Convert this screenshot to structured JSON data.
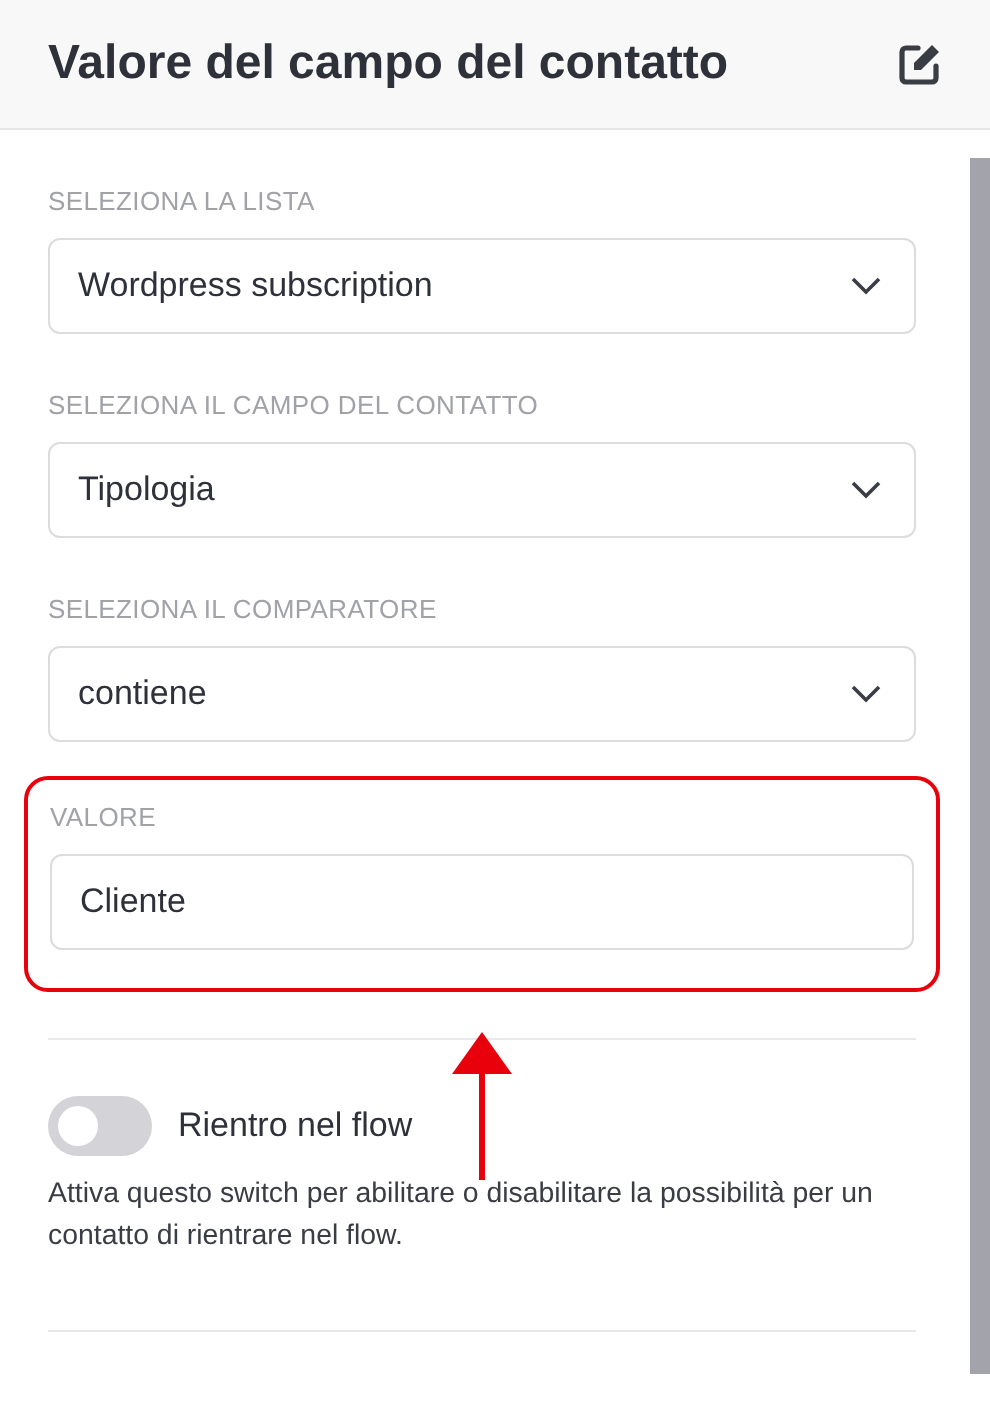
{
  "header": {
    "title": "Valore del campo del contatto"
  },
  "fields": [
    {
      "kind": "select",
      "label": "SELEZIONA LA LISTA",
      "value": "Wordpress subscription",
      "highlighted": false
    },
    {
      "kind": "select",
      "label": "SELEZIONA IL CAMPO DEL CONTATTO",
      "value": "Tipologia",
      "highlighted": false
    },
    {
      "kind": "select",
      "label": "SELEZIONA IL COMPARATORE",
      "value": "contiene",
      "highlighted": false
    },
    {
      "kind": "input",
      "label": "VALORE",
      "value": "Cliente",
      "highlighted": true
    }
  ],
  "toggle": {
    "label": "Rientro nel flow",
    "on": false,
    "description": "Attiva questo switch per abilitare o disabilitare la possibilità per un contatto di rientrare nel flow."
  }
}
